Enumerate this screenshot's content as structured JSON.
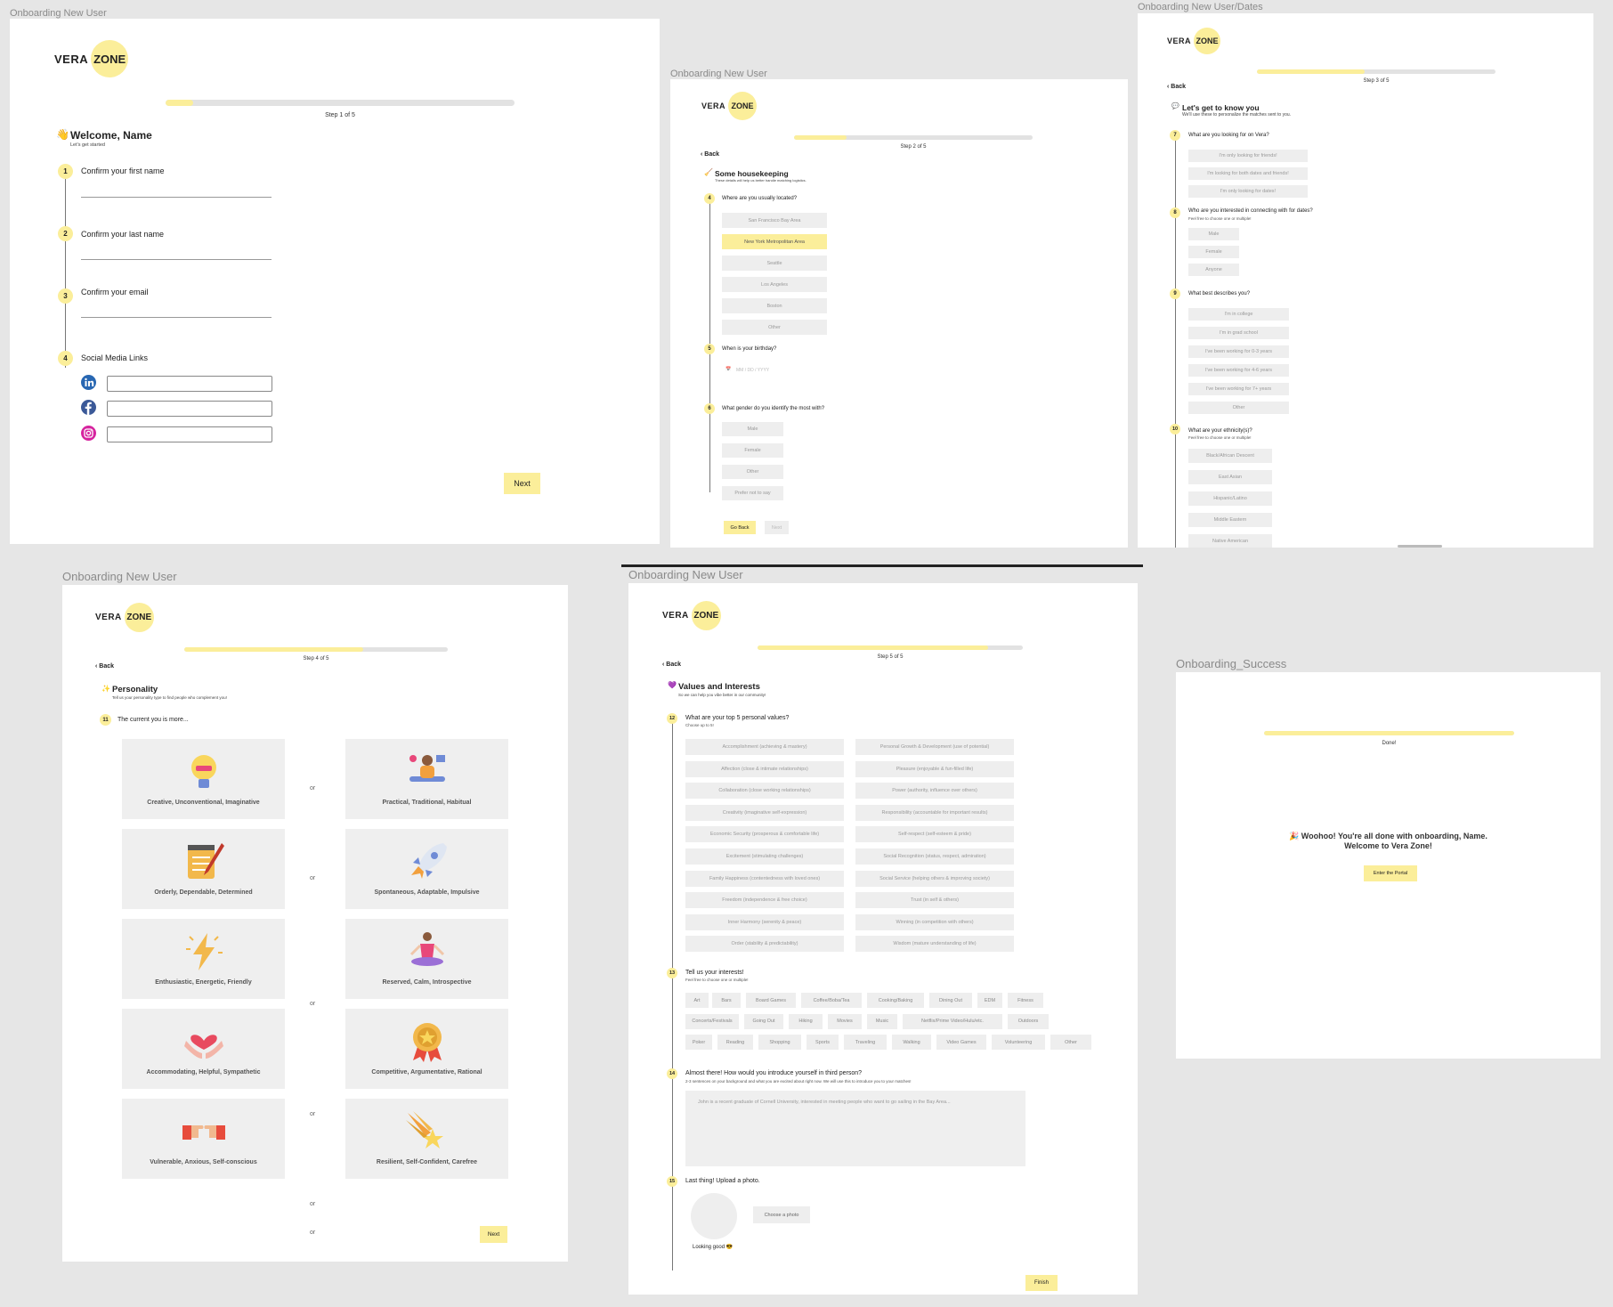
{
  "frames": {
    "f1": {
      "title": "Onboarding New User"
    },
    "f2": {
      "title": "Onboarding New User"
    },
    "f3": {
      "title": "Onboarding New User/Dates"
    },
    "f4": {
      "title": "Onboarding New User"
    },
    "f5": {
      "title": "Onboarding New User"
    },
    "f6": {
      "title": "Onboarding_Success"
    }
  },
  "logo": {
    "vera": "VERA",
    "zone": "ZONE"
  },
  "colors": {
    "accent": "#fbee9a",
    "option_bg": "#eeeeee",
    "canvas": "#e6e6e6"
  },
  "step1": {
    "progress": 0.08,
    "step_label": "Step 1 of 5",
    "title": "Welcome, Name",
    "subtitle": "Let's get started",
    "q1": {
      "num": "1",
      "label": "Confirm your first name"
    },
    "q2": {
      "num": "2",
      "label": "Confirm your last name"
    },
    "q3": {
      "num": "3",
      "label": "Confirm your email"
    },
    "q4": {
      "num": "4",
      "label": "Social Media Links"
    },
    "next": "Next"
  },
  "step2": {
    "progress": 0.22,
    "step_label": "Step 2 of 5",
    "back": "Back",
    "title": "Some housekeeping",
    "subtitle": "These details will help us better handle matching logistics.",
    "q4": {
      "num": "4",
      "label": "Where are you usually located?",
      "options": [
        "San Francisco Bay Area",
        "New York Metropolitan Area",
        "Seattle",
        "Los Angeles",
        "Boston",
        "Other"
      ],
      "selected": "New York Metropolitan Area"
    },
    "q5": {
      "num": "5",
      "label": "When is your birthday?",
      "date_placeholder": "MM / DD / YYYY"
    },
    "q6": {
      "num": "6",
      "label": "What gender do you identify the most with?",
      "options": [
        "Male",
        "Female",
        "Other",
        "Prefer not to say"
      ]
    },
    "go_back": "Go Back",
    "next": "Next"
  },
  "step3": {
    "progress": 0.45,
    "step_label": "Step 3 of 5",
    "back": "Back",
    "title": "Let's get to know you",
    "subtitle": "We'll use these to personalize the matches sent to you.",
    "q7": {
      "num": "7",
      "label": "What are you looking for on Vera?",
      "options": [
        "I'm only looking for friends!",
        "I'm looking for both dates and friends!",
        "I'm only looking for dates!"
      ]
    },
    "q8": {
      "num": "8",
      "label": "Who are you interested in connecting with for dates?",
      "sub": "Feel free to choose one or multiple!",
      "options": [
        "Male",
        "Female",
        "Anyone"
      ]
    },
    "q9": {
      "num": "9",
      "label": "What best describes you?",
      "options": [
        "I'm in college",
        "I'm in grad school",
        "I've been working for 0-3 years",
        "I've been working for 4-6 years",
        "I've been working for 7+ years",
        "Other"
      ]
    },
    "q10": {
      "num": "10",
      "label": "What are your ethnicity(s)?",
      "sub": "Feel free to choose one or multiple!",
      "options": [
        "Black/African Descent",
        "East Asian",
        "Hispanic/Latino",
        "Middle Eastern",
        "Native American"
      ]
    }
  },
  "step4": {
    "progress": 0.68,
    "step_label": "Step 4 of 5",
    "back": "Back",
    "title": "Personality",
    "subtitle": "Tell us your personality type to find people who complement you!",
    "q11": {
      "num": "11",
      "label": "The current you is more..."
    },
    "pairs": [
      {
        "left": "Creative, Unconventional, Imaginative",
        "right": "Practical, Traditional, Habitual"
      },
      {
        "left": "Orderly, Dependable, Determined",
        "right": "Spontaneous, Adaptable, Impulsive"
      },
      {
        "left": "Enthusiastic, Energetic, Friendly",
        "right": "Reserved, Calm, Introspective"
      },
      {
        "left": "Accommodating, Helpful, Sympathetic",
        "right": "Competitive, Argumentative, Rational"
      },
      {
        "left": "Vulnerable, Anxious, Self-conscious",
        "right": "Resilient, Self-Confident, Carefree"
      }
    ],
    "or": "or",
    "next": "Next"
  },
  "step5": {
    "progress": 0.87,
    "step_label": "Step 5 of 5",
    "back": "Back",
    "title": "Values and Interests",
    "subtitle": "So we can help you vibe better in our community!",
    "q12": {
      "num": "12",
      "label": "What are your top 5 personal values?",
      "sub": "Choose up to 5!",
      "left": [
        "Accomplishment (achieving & mastery)",
        "Affection (close & intimate relationships)",
        "Collaboration (close working relationships)",
        "Creativity (imaginative self-expression)",
        "Economic Security (prosperous & comfortable life)",
        "Excitement (stimulating challenges)",
        "Family Happiness (contentedness with loved ones)",
        "Freedom (independence & free choice)",
        "Inner Harmony (serenity & peace)",
        "Order (stability & predictability)"
      ],
      "right": [
        "Personal Growth & Development (use of potential)",
        "Pleasure (enjoyable & fun-filled life)",
        "Power (authority, influence over others)",
        "Responsibility (accountable for important results)",
        "Self-respect (self-esteem & pride)",
        "Social Recognition (status, respect, admiration)",
        "Social Service (helping others & improving society)",
        "Trust (in self & others)",
        "Winning (in competition with others)",
        "Wisdom (mature understanding of life)"
      ]
    },
    "q13": {
      "num": "13",
      "label": "Tell us your interests!",
      "sub": "Feel free to choose one or multiple!",
      "row1": [
        "Art",
        "Bars",
        "Board Games",
        "Coffee/Boba/Tea",
        "Cooking/Baking",
        "Dining Out",
        "EDM",
        "Fitness"
      ],
      "row2": [
        "Concerts/Festivals",
        "Going Out",
        "Hiking",
        "Movies",
        "Music",
        "Netflix/Prime Video/Hulu/etc.",
        "Outdoors"
      ],
      "row3": [
        "Poker",
        "Reading",
        "Shopping",
        "Sports",
        "Traveling",
        "Walking",
        "Video Games",
        "Volunteering",
        "Other"
      ]
    },
    "q14": {
      "num": "14",
      "label": "Almost there! How would you introduce yourself in third person?",
      "sub": "2-3 sentences on your background and what you are excited about right now. We will use this to introduce you to your matches!",
      "placeholder": "John is a recent graduate of Cornell University, interested in meeting people who want to go sailing in the Bay Area..."
    },
    "q15": {
      "num": "15",
      "label": "Last thing! Upload a photo.",
      "choose": "Choose a photo",
      "caption": "Looking good 😎"
    },
    "finish": "Finish"
  },
  "success": {
    "progress": 1.0,
    "done": "Done!",
    "line1": "Woohoo! You're all done with onboarding, Name.",
    "line2": "Welcome to Vera Zone!",
    "enter": "Enter the Portal"
  }
}
